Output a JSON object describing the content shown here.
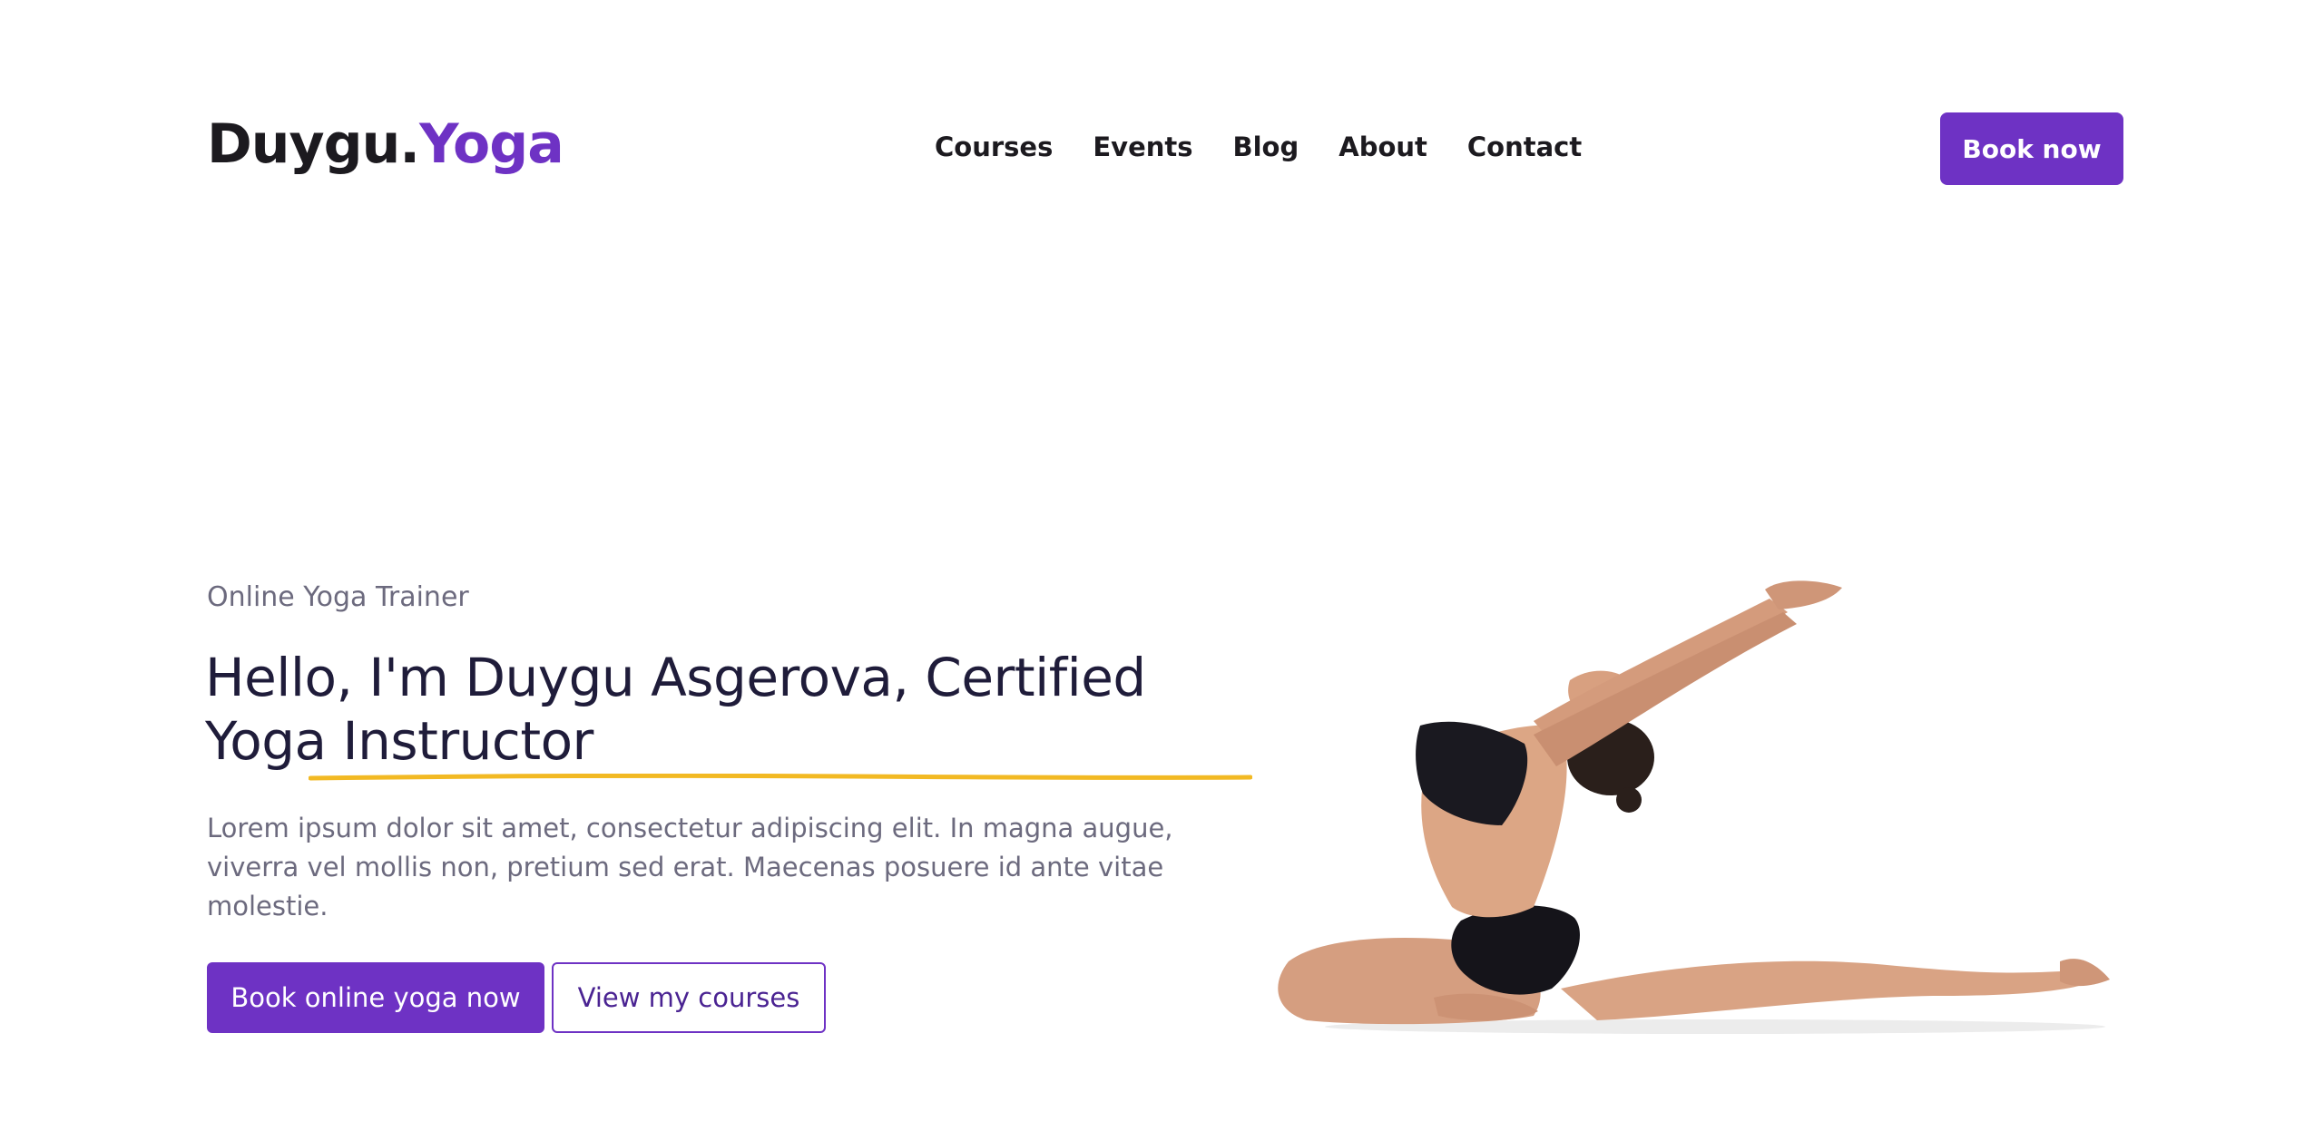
{
  "header": {
    "logo_main": "Duygu.",
    "logo_accent": "Yoga",
    "nav": [
      {
        "label": "Courses"
      },
      {
        "label": "Events"
      },
      {
        "label": "Blog"
      },
      {
        "label": "About"
      },
      {
        "label": "Contact"
      }
    ],
    "cta_label": "Book now"
  },
  "hero": {
    "eyebrow": "Online Yoga Trainer",
    "headline": "Hello, I'm Duygu Asgerova, Certified Yoga Instructor",
    "description": "Lorem ipsum dolor sit amet, consectetur adipiscing elit. In magna augue, viverra vel mollis non, pretium sed erat. Maecenas posuere id ante vitae molestie.",
    "primary_button": "Book online yoga now",
    "secondary_button": "View my courses"
  },
  "colors": {
    "accent": "#6e32c4",
    "underline": "#f2b923",
    "heading": "#1f1c3a",
    "muted": "#6c6a7e"
  }
}
